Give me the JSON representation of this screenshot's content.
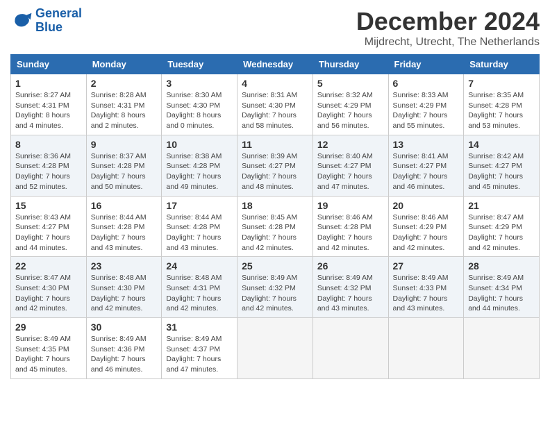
{
  "logo": {
    "line1": "General",
    "line2": "Blue"
  },
  "title": "December 2024",
  "location": "Mijdrecht, Utrecht, The Netherlands",
  "days_of_week": [
    "Sunday",
    "Monday",
    "Tuesday",
    "Wednesday",
    "Thursday",
    "Friday",
    "Saturday"
  ],
  "weeks": [
    [
      {
        "day": "1",
        "sunrise": "8:27 AM",
        "sunset": "4:31 PM",
        "daylight": "8 hours and 4 minutes"
      },
      {
        "day": "2",
        "sunrise": "8:28 AM",
        "sunset": "4:31 PM",
        "daylight": "8 hours and 2 minutes"
      },
      {
        "day": "3",
        "sunrise": "8:30 AM",
        "sunset": "4:30 PM",
        "daylight": "8 hours and 0 minutes"
      },
      {
        "day": "4",
        "sunrise": "8:31 AM",
        "sunset": "4:30 PM",
        "daylight": "7 hours and 58 minutes"
      },
      {
        "day": "5",
        "sunrise": "8:32 AM",
        "sunset": "4:29 PM",
        "daylight": "7 hours and 56 minutes"
      },
      {
        "day": "6",
        "sunrise": "8:33 AM",
        "sunset": "4:29 PM",
        "daylight": "7 hours and 55 minutes"
      },
      {
        "day": "7",
        "sunrise": "8:35 AM",
        "sunset": "4:28 PM",
        "daylight": "7 hours and 53 minutes"
      }
    ],
    [
      {
        "day": "8",
        "sunrise": "8:36 AM",
        "sunset": "4:28 PM",
        "daylight": "7 hours and 52 minutes"
      },
      {
        "day": "9",
        "sunrise": "8:37 AM",
        "sunset": "4:28 PM",
        "daylight": "7 hours and 50 minutes"
      },
      {
        "day": "10",
        "sunrise": "8:38 AM",
        "sunset": "4:28 PM",
        "daylight": "7 hours and 49 minutes"
      },
      {
        "day": "11",
        "sunrise": "8:39 AM",
        "sunset": "4:27 PM",
        "daylight": "7 hours and 48 minutes"
      },
      {
        "day": "12",
        "sunrise": "8:40 AM",
        "sunset": "4:27 PM",
        "daylight": "7 hours and 47 minutes"
      },
      {
        "day": "13",
        "sunrise": "8:41 AM",
        "sunset": "4:27 PM",
        "daylight": "7 hours and 46 minutes"
      },
      {
        "day": "14",
        "sunrise": "8:42 AM",
        "sunset": "4:27 PM",
        "daylight": "7 hours and 45 minutes"
      }
    ],
    [
      {
        "day": "15",
        "sunrise": "8:43 AM",
        "sunset": "4:27 PM",
        "daylight": "7 hours and 44 minutes"
      },
      {
        "day": "16",
        "sunrise": "8:44 AM",
        "sunset": "4:28 PM",
        "daylight": "7 hours and 43 minutes"
      },
      {
        "day": "17",
        "sunrise": "8:44 AM",
        "sunset": "4:28 PM",
        "daylight": "7 hours and 43 minutes"
      },
      {
        "day": "18",
        "sunrise": "8:45 AM",
        "sunset": "4:28 PM",
        "daylight": "7 hours and 42 minutes"
      },
      {
        "day": "19",
        "sunrise": "8:46 AM",
        "sunset": "4:28 PM",
        "daylight": "7 hours and 42 minutes"
      },
      {
        "day": "20",
        "sunrise": "8:46 AM",
        "sunset": "4:29 PM",
        "daylight": "7 hours and 42 minutes"
      },
      {
        "day": "21",
        "sunrise": "8:47 AM",
        "sunset": "4:29 PM",
        "daylight": "7 hours and 42 minutes"
      }
    ],
    [
      {
        "day": "22",
        "sunrise": "8:47 AM",
        "sunset": "4:30 PM",
        "daylight": "7 hours and 42 minutes"
      },
      {
        "day": "23",
        "sunrise": "8:48 AM",
        "sunset": "4:30 PM",
        "daylight": "7 hours and 42 minutes"
      },
      {
        "day": "24",
        "sunrise": "8:48 AM",
        "sunset": "4:31 PM",
        "daylight": "7 hours and 42 minutes"
      },
      {
        "day": "25",
        "sunrise": "8:49 AM",
        "sunset": "4:32 PM",
        "daylight": "7 hours and 42 minutes"
      },
      {
        "day": "26",
        "sunrise": "8:49 AM",
        "sunset": "4:32 PM",
        "daylight": "7 hours and 43 minutes"
      },
      {
        "day": "27",
        "sunrise": "8:49 AM",
        "sunset": "4:33 PM",
        "daylight": "7 hours and 43 minutes"
      },
      {
        "day": "28",
        "sunrise": "8:49 AM",
        "sunset": "4:34 PM",
        "daylight": "7 hours and 44 minutes"
      }
    ],
    [
      {
        "day": "29",
        "sunrise": "8:49 AM",
        "sunset": "4:35 PM",
        "daylight": "7 hours and 45 minutes"
      },
      {
        "day": "30",
        "sunrise": "8:49 AM",
        "sunset": "4:36 PM",
        "daylight": "7 hours and 46 minutes"
      },
      {
        "day": "31",
        "sunrise": "8:49 AM",
        "sunset": "4:37 PM",
        "daylight": "7 hours and 47 minutes"
      },
      null,
      null,
      null,
      null
    ]
  ]
}
